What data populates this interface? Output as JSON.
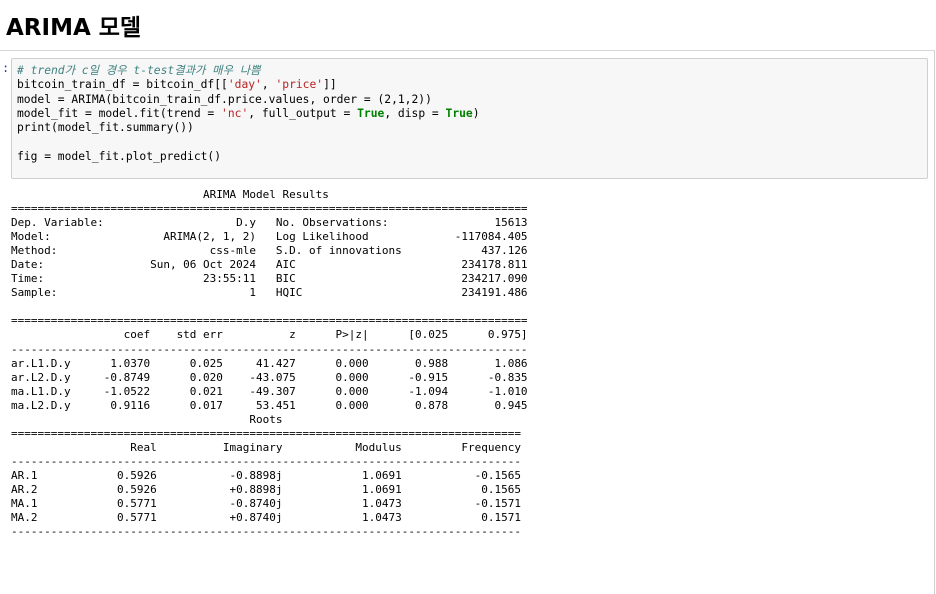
{
  "heading": "ARIMA 모델",
  "cell": {
    "prompt": ":",
    "code_lines": [
      [
        {
          "t": "# trend가 c일 경우 t-test결과가 매우 나쁨",
          "c": "cm"
        }
      ],
      [
        {
          "t": "bitcoin_train_df = bitcoin_df[["
        },
        {
          "t": "'day'",
          "c": "st"
        },
        {
          "t": ", "
        },
        {
          "t": "'price'",
          "c": "st"
        },
        {
          "t": "]]"
        }
      ],
      [
        {
          "t": "model = ARIMA(bitcoin_train_df.price.values, order = (2,1,2))"
        }
      ],
      [
        {
          "t": "model_fit = model.fit(trend = "
        },
        {
          "t": "'nc'",
          "c": "st"
        },
        {
          "t": ", full_output = "
        },
        {
          "t": "True",
          "c": "kw"
        },
        {
          "t": ", disp = "
        },
        {
          "t": "True",
          "c": "kw"
        },
        {
          "t": ")"
        }
      ],
      [
        {
          "t": "print",
          "c": "kw2"
        },
        {
          "t": "(model_fit.summary())"
        }
      ],
      [],
      [
        {
          "t": "fig = model_fit.plot_predict()"
        }
      ]
    ]
  },
  "output_lines": [
    "                             ARIMA Model Results",
    "==============================================================================",
    "Dep. Variable:                    D.y   No. Observations:                15613",
    "Model:                 ARIMA(2, 1, 2)   Log Likelihood             -117084.405",
    "Method:                       css-mle   S.D. of innovations            437.126",
    "Date:                Sun, 06 Oct 2024   AIC                         234178.811",
    "Time:                        23:55:11   BIC                         234217.090",
    "Sample:                             1   HQIC                        234191.486",
    "",
    "==============================================================================",
    "                 coef    std err          z      P>|z|      [0.025      0.975]",
    "------------------------------------------------------------------------------",
    "ar.L1.D.y      1.0370      0.025     41.427      0.000       0.988       1.086",
    "ar.L2.D.y     -0.8749      0.020    -43.075      0.000      -0.915      -0.835",
    "ma.L1.D.y     -1.0522      0.021    -49.307      0.000      -1.094      -1.010",
    "ma.L2.D.y      0.9116      0.017     53.451      0.000       0.878       0.945",
    "                                    Roots",
    "=============================================================================",
    "                  Real          Imaginary           Modulus         Frequency",
    "-----------------------------------------------------------------------------",
    "AR.1            0.5926           -0.8898j            1.0691           -0.1565",
    "AR.2            0.5926           +0.8898j            1.0691            0.1565",
    "MA.1            0.5771           -0.8740j            1.0473           -0.1571",
    "MA.2            0.5771           +0.8740j            1.0473            0.1571",
    "-----------------------------------------------------------------------------"
  ]
}
